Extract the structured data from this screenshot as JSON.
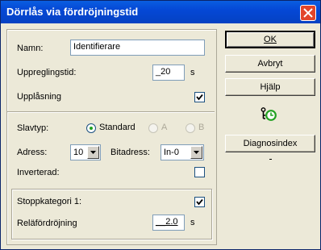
{
  "window": {
    "title": "Dörrlås via fördröjningstid"
  },
  "form": {
    "name_label": "Namn:",
    "name_value": "Identifierare",
    "repeat_label": "Uppreglingstid:",
    "repeat_value": "_20",
    "repeat_unit": "s",
    "unlock_label": "Upplåsning",
    "unlock_checked": true,
    "slave_type_label": "Slavtyp:",
    "slave_options": [
      {
        "label": "Standard",
        "selected": true,
        "disabled": false
      },
      {
        "label": "A",
        "selected": false,
        "disabled": true
      },
      {
        "label": "B",
        "selected": false,
        "disabled": true
      }
    ],
    "address_label": "Adress:",
    "address_value": "10",
    "bitaddress_label": "Bitadress:",
    "bitaddress_value": "In-0",
    "inverted_label": "Inverterad:",
    "inverted_checked": false,
    "stop_category_label": "Stoppkategori 1:",
    "stop_category_checked": true,
    "relay_delay_label": "Reläfördröjning",
    "relay_delay_value": "__2.0",
    "relay_delay_unit": "s"
  },
  "buttons": {
    "ok": "OK",
    "cancel": "Avbryt",
    "help": "Hjälp",
    "diagnostics": "Diagnosindex"
  },
  "icons": {
    "close": "close-icon",
    "diagnostics": "io-timer-icon"
  },
  "colors": {
    "titlebar": "#0548d6",
    "close": "#e2452b",
    "accent_green": "#21a121"
  }
}
